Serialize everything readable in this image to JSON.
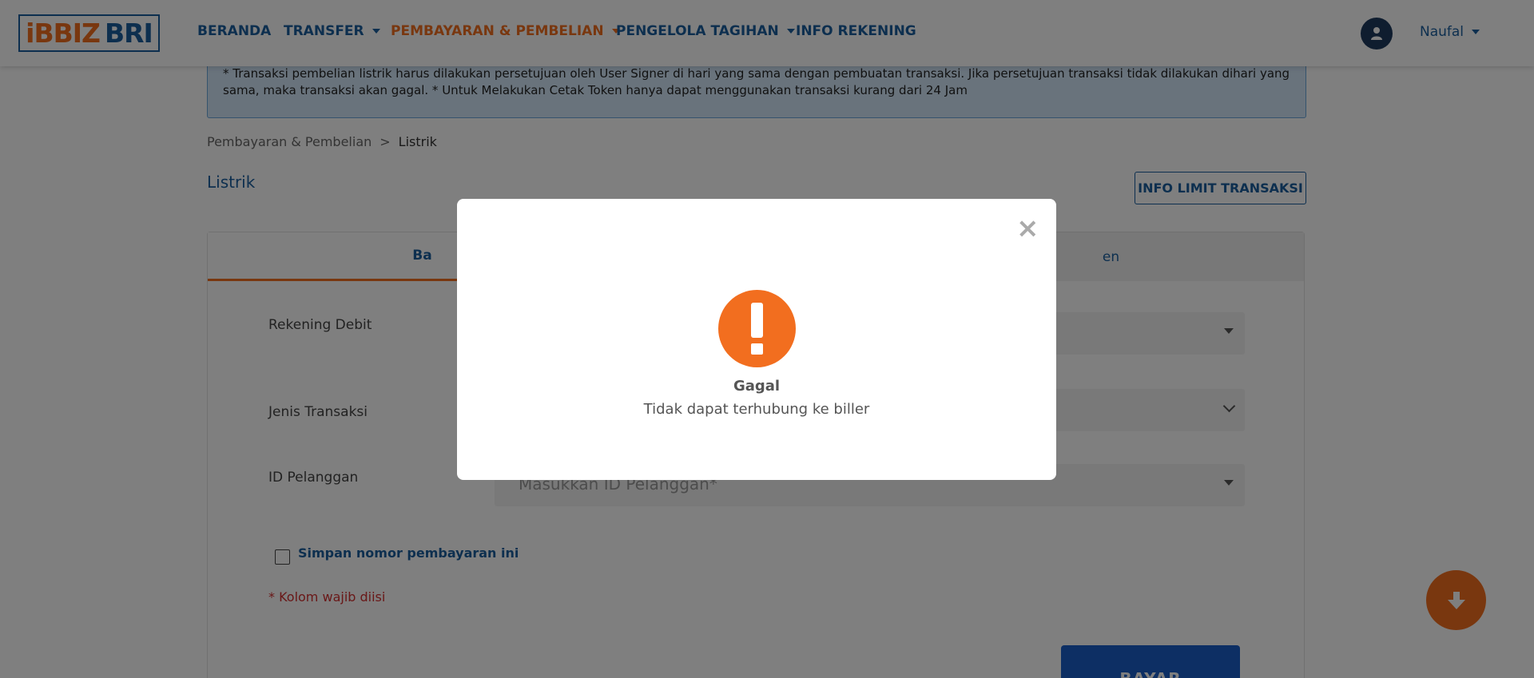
{
  "brand": {
    "logo_part1": "iBBIZ",
    "logo_part2": "BRI"
  },
  "nav": {
    "items": [
      {
        "label": "BERANDA"
      },
      {
        "label": "TRANSFER"
      },
      {
        "label": "PEMBAYARAN & PEMBELIAN"
      },
      {
        "label": "PENGELOLA TAGIHAN"
      },
      {
        "label": "INFO REKENING"
      }
    ],
    "active": "PEMBAYARAN & PEMBELIAN",
    "user_name": "Naufal"
  },
  "notice": {
    "text": "* Transaksi pembelian listrik harus dilakukan persetujuan oleh User Signer di hari yang sama dengan pembuatan transaksi. Jika persetujuan transaksi tidak dilakukan dihari yang sama, maka transaksi akan gagal. * Untuk Melakukan Cetak Token hanya dapat menggunakan transaksi kurang dari 24 Jam"
  },
  "breadcrumb": {
    "parent": "Pembayaran & Pembelian",
    "separator": ">",
    "current": "Listrik"
  },
  "page": {
    "title": "Listrik",
    "limit_button": "INFO LIMIT TRANSAKSI"
  },
  "tabs": {
    "active_partial": "Ba",
    "inactive_partial": "en"
  },
  "form": {
    "rekening_debit_label": "Rekening Debit",
    "jenis_transaksi_label": "Jenis Transaksi",
    "id_pelanggan_label": "ID Pelanggan",
    "id_pelanggan_placeholder": "Masukkan ID Pelanggan*",
    "save_checkbox_label": "Simpan nomor pembayaran ini",
    "required_note": "* Kolom wajib diisi",
    "submit_label": "BAYAR"
  },
  "modal": {
    "close_glyph": "×",
    "title": "Gagal",
    "message": "Tidak dapat terhubung ke biller"
  },
  "colors": {
    "primary": "#1a5e9e",
    "accent": "#f26e1f",
    "error": "#d32f2f"
  }
}
